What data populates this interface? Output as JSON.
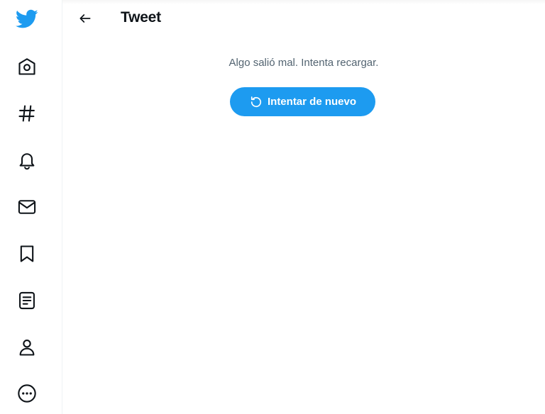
{
  "page": {
    "title": "Tweet",
    "error_message": "Algo salió mal. Intenta recargar.",
    "retry_label": "Intentar de nuevo"
  },
  "sidebar": {
    "items": [
      {
        "name": "twitter-logo",
        "icon": "bird-icon"
      },
      {
        "name": "home",
        "icon": "home-icon"
      },
      {
        "name": "explore",
        "icon": "hashtag-icon"
      },
      {
        "name": "notifications",
        "icon": "bell-icon"
      },
      {
        "name": "messages",
        "icon": "envelope-icon"
      },
      {
        "name": "bookmarks",
        "icon": "bookmark-icon"
      },
      {
        "name": "lists",
        "icon": "list-icon"
      },
      {
        "name": "profile",
        "icon": "person-icon"
      },
      {
        "name": "more",
        "icon": "more-icon"
      }
    ]
  },
  "colors": {
    "brand": "#1d9bf0",
    "text": "#0f1419",
    "muted": "#536471"
  }
}
